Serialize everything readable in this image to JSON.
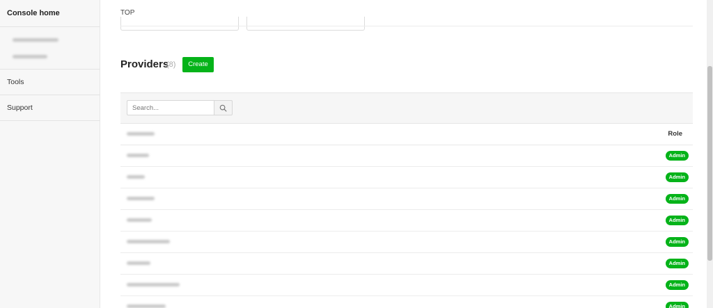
{
  "sidebar": {
    "home_label": "Console home",
    "items": [
      {
        "label": "Tools"
      },
      {
        "label": "Support"
      }
    ]
  },
  "breadcrumb": "TOP",
  "providers": {
    "title": "Providers",
    "count": "(8)",
    "create_label": "Create",
    "search_placeholder": "Search...",
    "columns": {
      "role": "Role"
    },
    "rows": [
      {
        "role": "Admin"
      },
      {
        "role": "Admin"
      },
      {
        "role": "Admin"
      },
      {
        "role": "Admin"
      },
      {
        "role": "Admin"
      },
      {
        "role": "Admin"
      },
      {
        "role": "Admin"
      },
      {
        "role": "Admin"
      }
    ]
  },
  "colors": {
    "accent": "#05b319",
    "sidebar_bg": "#f7f7f7"
  },
  "icons": {
    "search": "search-icon"
  }
}
